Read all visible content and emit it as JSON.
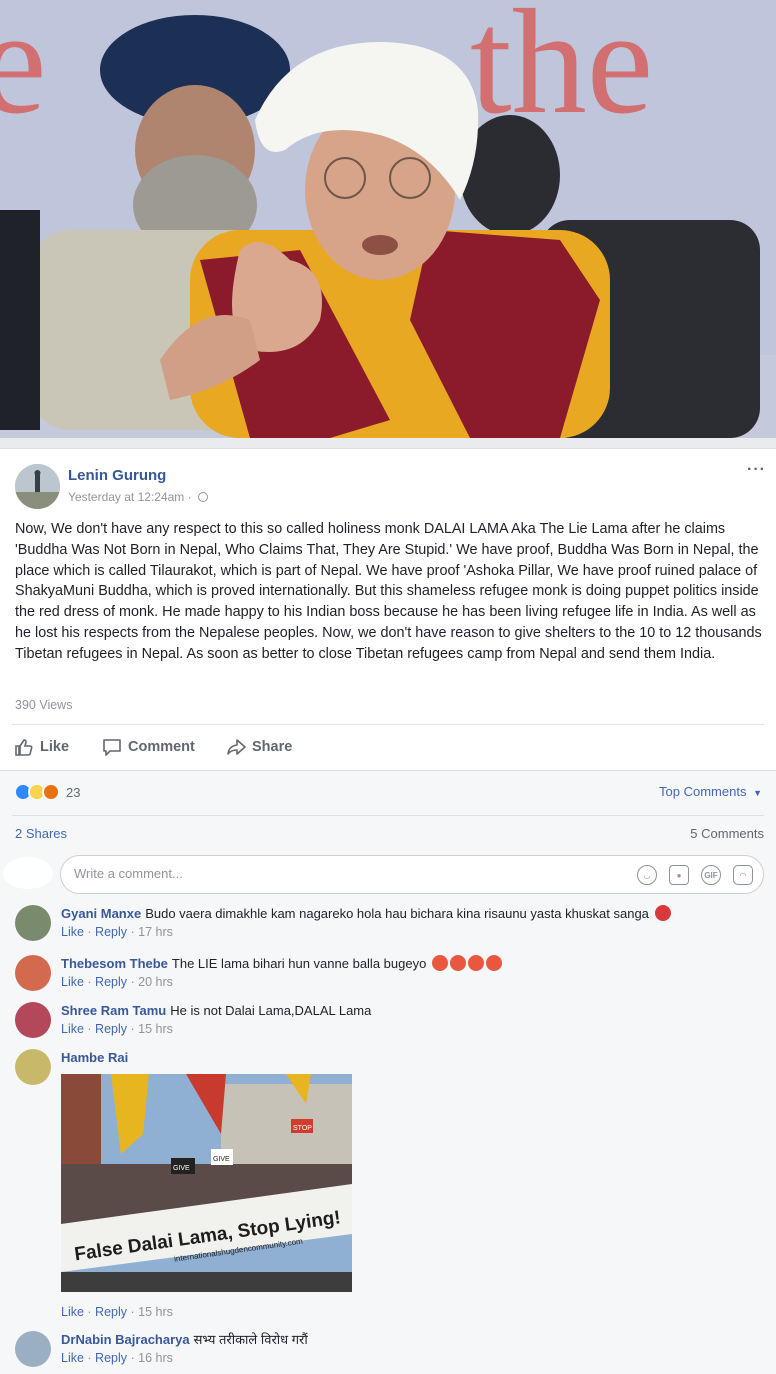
{
  "hero": {
    "background_text": [
      "e",
      "the"
    ],
    "alt_subject": "photo"
  },
  "post": {
    "author": "Lenin Gurung",
    "timestamp": "Yesterday at 12:24am",
    "privacy_separator": "·",
    "more": "···",
    "text": "Now, We don't have any respect to this so called holiness monk DALAI LAMA Aka The Lie Lama after he claims 'Buddha Was Not Born in Nepal, Who Claims That, They Are Stupid.' We have proof, Buddha Was Born in Nepal, the place which is called Tilaurakot, which is part of Nepal. We have proof 'Ashoka Pillar, We have proof ruined palace of ShakyaMuni Buddha, which is proved internationally. But this shameless refugee monk is doing puppet politics inside the red dress of monk. He made happy to his Indian boss because he has been living refugee life in India. As well as he lost his respects from the Nepalese peoples. Now, we don't have reason to give shelters to the 10 to 12 thousands Tibetan refugees in Nepal. As soon as better to close Tibetan refugees camp from Nepal and send them India.",
    "views": "390 Views"
  },
  "actions": {
    "like": "Like",
    "comment": "Comment",
    "share": "Share"
  },
  "ufi": {
    "reaction_count": "23",
    "top_comments": "Top Comments",
    "shares": "2 Shares",
    "comments_count": "5 Comments",
    "write_placeholder": "Write a comment...",
    "gif_label": "GIF"
  },
  "comments": [
    {
      "name": "Gyani Manxe",
      "text": "Budo vaera dimakhle kam nagareko hola hau bichara kina risaunu yasta khuskat sanga",
      "like": "Like",
      "reply": "Reply",
      "time": "17 hrs",
      "sep": " · "
    },
    {
      "name": "Thebesom Thebe",
      "text": "The LIE lama bihari hun vanne balla bugeyo",
      "like": "Like",
      "reply": "Reply",
      "time": "20 hrs",
      "sep": " · "
    },
    {
      "name": "Shree Ram Tamu",
      "text": "He is not Dalai Lama,DALAL Lama",
      "like": "Like",
      "reply": "Reply",
      "time": "15 hrs",
      "sep": " · "
    },
    {
      "name": "Hambe Rai",
      "text": "",
      "like": "Like",
      "reply": "Reply",
      "time": "15 hrs",
      "sep": " · ",
      "photo_banner": "False Dalai Lama, Stop Lying!",
      "photo_banner_url": "internationalshugdencommunity.com",
      "photo_signs": [
        "GIVE",
        "STOP",
        "GIVE"
      ]
    },
    {
      "name": "DrNabin Bajracharya",
      "text": "सभ्य तरीकाले विरोध गरौं",
      "like": "Like",
      "reply": "Reply",
      "time": "16 hrs",
      "sep": " · "
    }
  ],
  "colors": {
    "link": "#365899",
    "accent": "#4267b2",
    "meta": "#90949c"
  }
}
